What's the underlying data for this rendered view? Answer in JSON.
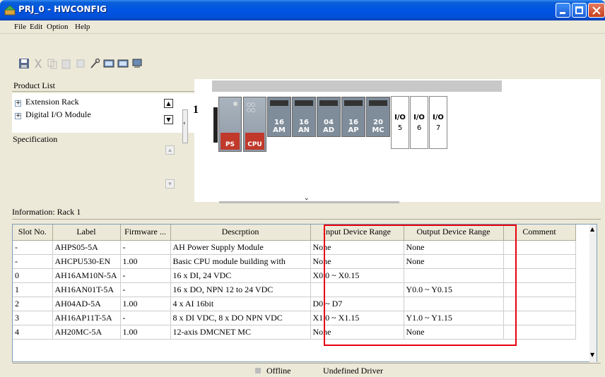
{
  "window": {
    "title": "PRJ_0 - HWCONFIG",
    "colors": {
      "titlebar": "#0054e3",
      "highlight": "#e8000f"
    }
  },
  "menu": {
    "items": [
      "File",
      "Edit",
      "Option",
      "Help"
    ]
  },
  "toolbar": {
    "icons": [
      "save-icon",
      "cut-icon",
      "copy-icon",
      "paste-icon",
      "delete-icon",
      "wrench-icon",
      "download-icon",
      "upload-icon",
      "scan-icon"
    ]
  },
  "product_list": {
    "header": "Product List",
    "items": [
      "Extension Rack",
      "Digital I/O Module"
    ],
    "specification_label": "Specification"
  },
  "rack": {
    "number": "1",
    "modules": [
      {
        "name": "PS",
        "color": "#c0392b"
      },
      {
        "name": "CPU",
        "color": "#c0392b"
      },
      {
        "line1": "16",
        "line2": "AM",
        "color": "#7f8c9a"
      },
      {
        "line1": "16",
        "line2": "AN",
        "color": "#7f8c9a"
      },
      {
        "line1": "04",
        "line2": "AD",
        "color": "#7f8c9a"
      },
      {
        "line1": "16",
        "line2": "AP",
        "color": "#7f8c9a"
      },
      {
        "line1": "20",
        "line2": "MC",
        "color": "#7f8c9a"
      }
    ],
    "empty_slots": [
      {
        "label": "I/O",
        "num": "5"
      },
      {
        "label": "I/O",
        "num": "6"
      },
      {
        "label": "I/O",
        "num": "7"
      }
    ]
  },
  "information": {
    "label": "Information: Rack 1",
    "columns": [
      "Slot No.",
      "Label",
      "Firmware ...",
      "Descrption",
      "Input Device Range",
      "Output Device Range",
      "Comment"
    ],
    "rows": [
      [
        "-",
        "AHPS05-5A",
        "-",
        "AH Power Supply Module",
        "None",
        "None",
        ""
      ],
      [
        "-",
        "AHCPU530-EN",
        "1.00",
        "Basic CPU module building with",
        "None",
        "None",
        ""
      ],
      [
        "0",
        "AH16AM10N-5A",
        "-",
        "16 x DI, 24 VDC",
        "X0.0 ~ X0.15",
        "",
        ""
      ],
      [
        "1",
        "AH16AN01T-5A",
        "-",
        "16 x DO, NPN 12 to 24 VDC",
        "",
        "Y0.0 ~ Y0.15",
        ""
      ],
      [
        "2",
        "AH04AD-5A",
        "1.00",
        "4 x AI 16bit",
        "D0 ~ D7",
        "",
        ""
      ],
      [
        "3",
        "AH16AP11T-5A",
        "-",
        "8 x DI VDC, 8 x DO NPN VDC",
        "X1.0 ~ X1.15",
        "Y1.0 ~ Y1.15",
        ""
      ],
      [
        "4",
        "AH20MC-5A",
        "1.00",
        "12-axis DMCNET MC",
        "None",
        "None",
        ""
      ]
    ]
  },
  "status": {
    "mode": "Offline",
    "driver": "Undefined Driver"
  }
}
